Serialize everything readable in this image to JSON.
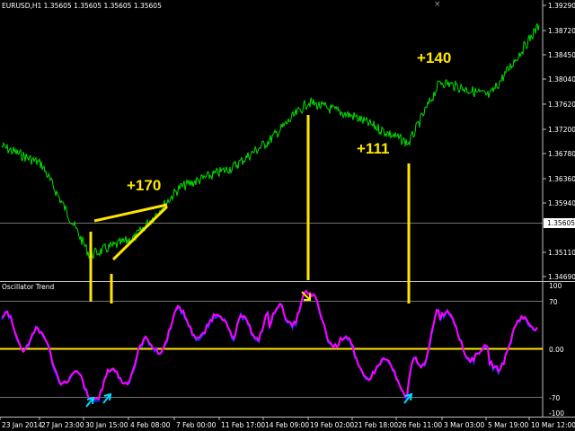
{
  "symbol_header": "EURUSD,H1  1.35605 1.35605 1.35605 1.35605",
  "indicator_name": "Oscillator Trend",
  "close_glyph": "×",
  "current_price": "1.35605",
  "price_axis": [
    "1.39290",
    "1.38720",
    "1.38450",
    "1.38040",
    "1.37620",
    "1.37200",
    "1.36780",
    "1.36360",
    "1.35940",
    "1.35110",
    "1.34690"
  ],
  "osc_axis": [
    "100",
    "70",
    "0.00",
    "-70",
    "-100"
  ],
  "time_axis": [
    "23 Jan 2014",
    "27 Jan 23:00",
    "30 Jan 15:00",
    "4 Feb 08:00",
    "7 Feb 00:00",
    "11 Feb 17:00",
    "14 Feb 09:00",
    "19 Feb 02:00",
    "21 Feb 18:00",
    "26 Feb 11:00",
    "3 Mar 03:00",
    "5 Mar 19:00",
    "10 Mar 12:00"
  ],
  "annotations": {
    "a1": "+170",
    "a2": "+111",
    "a3": "+140"
  },
  "colors": {
    "background": "#000000",
    "price": "#00e000",
    "oscillator": "#ff00ff",
    "oscillator_alt": "#2030ff",
    "signal": "#ffe600",
    "arrow": "#00d8ff",
    "grid": "#c0c0c0"
  },
  "chart_data": [
    {
      "type": "line",
      "title": "EURUSD,H1",
      "ylim": [
        1.3469,
        1.3929
      ],
      "x": [
        "23 Jan",
        "27 Jan",
        "30 Jan",
        "4 Feb",
        "7 Feb",
        "11 Feb",
        "14 Feb",
        "19 Feb",
        "21 Feb",
        "26 Feb",
        "3 Mar",
        "5 Mar",
        "10 Mar"
      ],
      "series": [
        {
          "values": [
            1.369,
            1.366,
            1.3505,
            1.3535,
            1.362,
            1.3655,
            1.37,
            1.3765,
            1.374,
            1.3695,
            1.38,
            1.3775,
            1.3895
          ]
        }
      ],
      "current": 1.35605
    },
    {
      "type": "line",
      "title": "Oscillator Trend",
      "ylim": [
        -100,
        100
      ],
      "levels": [
        70,
        0,
        -70
      ],
      "x": [
        "23 Jan",
        "27 Jan",
        "30 Jan",
        "4 Feb",
        "7 Feb",
        "11 Feb",
        "14 Feb",
        "19 Feb",
        "21 Feb",
        "26 Feb",
        "3 Mar",
        "5 Mar",
        "10 Mar"
      ],
      "series": [
        {
          "values": [
            40,
            5,
            -80,
            -20,
            45,
            30,
            40,
            72,
            -15,
            -55,
            50,
            -25,
            60
          ]
        }
      ]
    }
  ]
}
